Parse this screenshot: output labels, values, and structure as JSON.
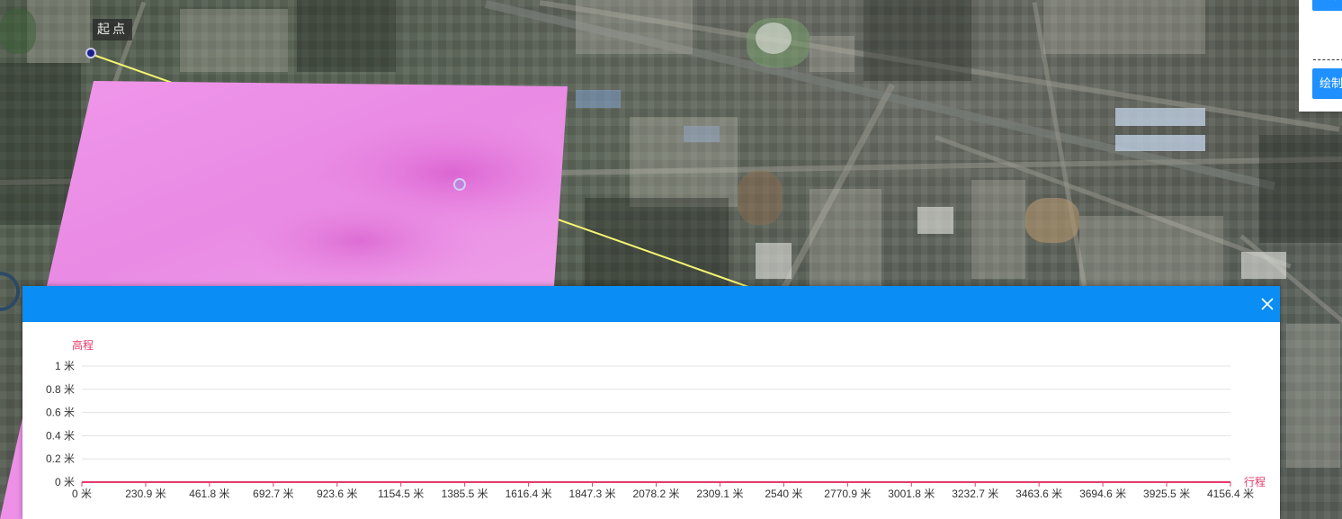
{
  "map": {
    "start_label": "起点"
  },
  "draw_panel": {
    "button_label": "绘制"
  },
  "profile_panel": {
    "close_icon": "close-icon"
  },
  "chart_data": {
    "type": "line",
    "title": "",
    "ylabel": "高程",
    "xlabel": "行程",
    "ylim": [
      0,
      1
    ],
    "xlim": [
      0,
      4156.4
    ],
    "y_ticks": [
      "0 米",
      "0.2 米",
      "0.4 米",
      "0.6 米",
      "0.8 米",
      "1 米"
    ],
    "x_ticks": [
      "0 米",
      "230.9 米",
      "461.8 米",
      "692.7 米",
      "923.6 米",
      "1154.5 米",
      "1385.5 米",
      "1616.4 米",
      "1847.3 米",
      "2078.2 米",
      "2309.1 米",
      "2540 米",
      "2770.9 米",
      "3001.8 米",
      "3232.7 米",
      "3463.6 米",
      "3694.6 米",
      "3925.5 米",
      "4156.4 米"
    ],
    "series": [
      {
        "x": [
          0,
          4156.4
        ],
        "y": [
          0,
          0
        ]
      }
    ],
    "grid": true,
    "accent_color": "#e53a6a"
  },
  "colors": {
    "header_blue": "#0a8df5",
    "button_blue": "#1e90ff",
    "polygon_pink": "#ee90e8",
    "profile_line": "#f5f570"
  }
}
